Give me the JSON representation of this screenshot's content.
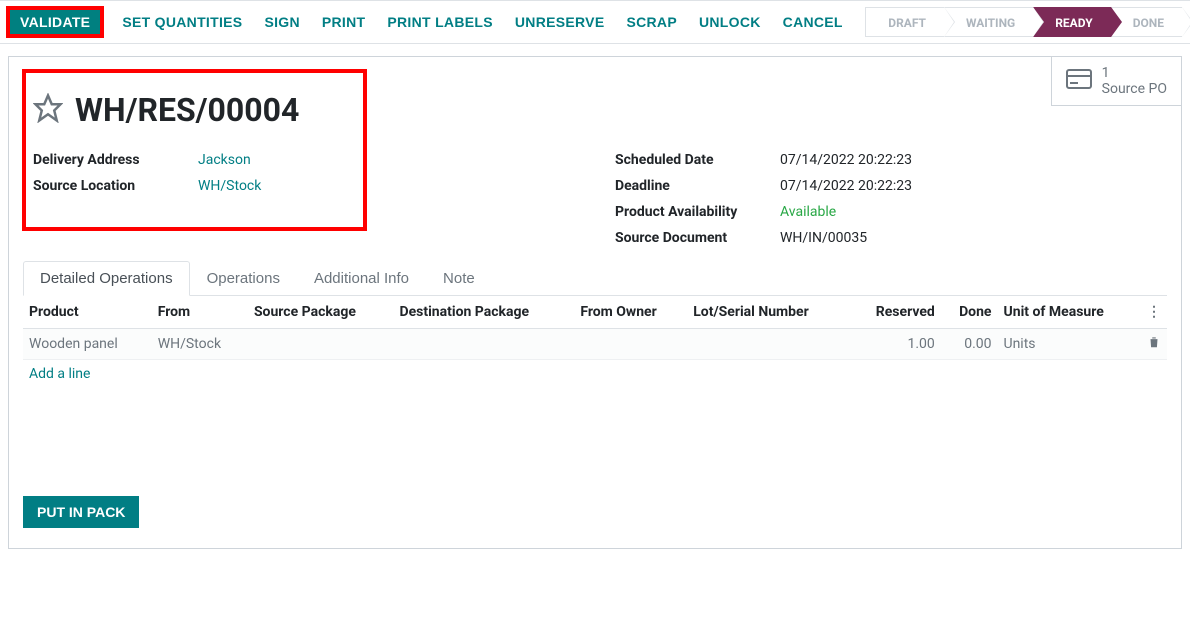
{
  "toolbar": {
    "validate": "VALIDATE",
    "set_quantities": "SET QUANTITIES",
    "sign": "SIGN",
    "print": "PRINT",
    "print_labels": "PRINT LABELS",
    "unreserve": "UNRESERVE",
    "scrap": "SCRAP",
    "unlock": "UNLOCK",
    "cancel": "CANCEL"
  },
  "status_arrows": {
    "draft": "DRAFT",
    "waiting": "WAITING",
    "ready": "READY",
    "done": "DONE"
  },
  "stat": {
    "count": "1",
    "label": "Source PO"
  },
  "title": "WH/RES/00004",
  "left": {
    "delivery_address_label": "Delivery Address",
    "delivery_address_value": "Jackson",
    "source_location_label": "Source Location",
    "source_location_value": "WH/Stock"
  },
  "right": {
    "scheduled_date_label": "Scheduled Date",
    "scheduled_date_value": "07/14/2022 20:22:23",
    "deadline_label": "Deadline",
    "deadline_value": "07/14/2022 20:22:23",
    "availability_label": "Product Availability",
    "availability_value": "Available",
    "source_doc_label": "Source Document",
    "source_doc_value": "WH/IN/00035"
  },
  "tabs": {
    "detailed_operations": "Detailed Operations",
    "operations": "Operations",
    "additional_info": "Additional Info",
    "note": "Note"
  },
  "table": {
    "headers": {
      "product": "Product",
      "from": "From",
      "source_package": "Source Package",
      "destination_package": "Destination Package",
      "from_owner": "From Owner",
      "lot": "Lot/Serial Number",
      "reserved": "Reserved",
      "done": "Done",
      "uom": "Unit of Measure"
    },
    "row": {
      "product": "Wooden panel",
      "from": "WH/Stock",
      "source_package": "",
      "destination_package": "",
      "from_owner": "",
      "lot": "",
      "reserved": "1.00",
      "done": "0.00",
      "uom": "Units"
    },
    "add_line": "Add a line"
  },
  "put_in_pack": "PUT IN PACK"
}
